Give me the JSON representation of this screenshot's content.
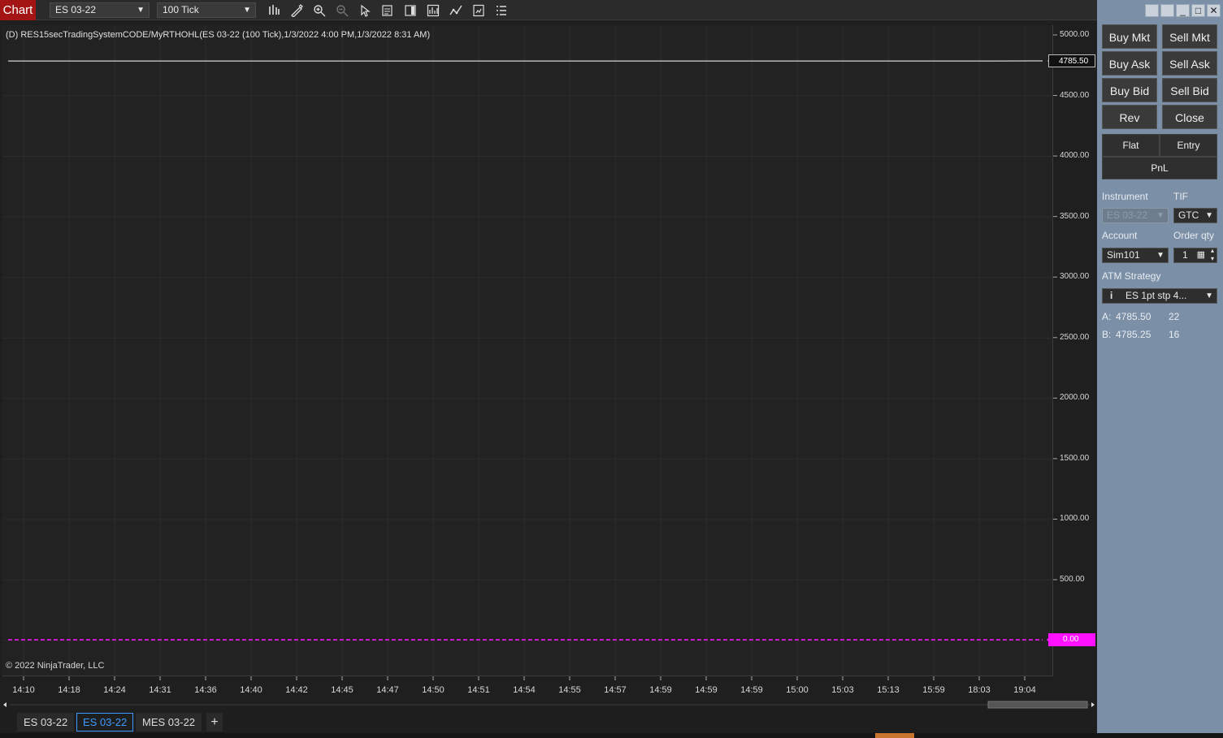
{
  "toolbar": {
    "app_tab": "Chart",
    "instrument": "ES 03-22",
    "interval": "100 Tick",
    "tools": [
      "bar-type-icon",
      "drawing-tool-icon",
      "zoom-in-icon",
      "zoom-out-icon",
      "pointer-icon",
      "data-box-icon",
      "chart-trader-icon",
      "strategies-icon",
      "indicators-icon",
      "templates-icon",
      "properties-icon"
    ]
  },
  "chart": {
    "title": "(D) RES15secTradingSystemCODE/MyRTHOHL(ES 03-22 (100 Tick),1/3/2022 4:00 PM,1/3/2022 8:31 AM)",
    "copyright": "© 2022 NinjaTrader, LLC",
    "last_price": "4785.50",
    "zero_line": "0.00",
    "colors": {
      "background": "#222222",
      "price_line": "#ffffff",
      "zero_line": "#ff10ff"
    }
  },
  "chart_data": {
    "type": "line",
    "title": "(D) RES15secTradingSystemCODE/MyRTHOHL(ES 03-22 (100 Tick),1/3/2022 4:00 PM,1/3/2022 8:31 AM)",
    "x": [
      "14:10",
      "14:18",
      "14:24",
      "14:31",
      "14:36",
      "14:40",
      "14:42",
      "14:45",
      "14:47",
      "14:50",
      "14:51",
      "14:54",
      "14:55",
      "14:57",
      "14:59",
      "14:59",
      "14:59",
      "15:00",
      "15:03",
      "15:13",
      "15:59",
      "18:03",
      "19:04"
    ],
    "y_ticks": [
      "5000.00",
      "4500.00",
      "4000.00",
      "3500.00",
      "3000.00",
      "2500.00",
      "2000.00",
      "1500.00",
      "1000.00",
      "500.00"
    ],
    "ylim": [
      -200,
      5200
    ],
    "series": [
      {
        "values": [
          4785,
          4785,
          4785,
          4785,
          4785,
          4785,
          4785,
          4785,
          4785,
          4785,
          4785,
          4785,
          4785,
          4785,
          4785,
          4785,
          4785,
          4785,
          4785,
          4785,
          4785,
          4785,
          4785.5
        ]
      },
      {
        "values": [
          0,
          0,
          0,
          0,
          0,
          0,
          0,
          0,
          0,
          0,
          0,
          0,
          0,
          0,
          0,
          0,
          0,
          0,
          0,
          0,
          0,
          0,
          0
        ]
      }
    ],
    "grid": true
  },
  "bottom_tabs": [
    {
      "label": "ES 03-22",
      "active": false
    },
    {
      "label": "ES 03-22",
      "active": true
    },
    {
      "label": "MES 03-22",
      "active": false
    }
  ],
  "add_tab": "+",
  "order_panel": {
    "buttons": {
      "buy_mkt": "Buy Mkt",
      "sell_mkt": "Sell Mkt",
      "buy_ask": "Buy Ask",
      "sell_ask": "Sell Ask",
      "buy_bid": "Buy Bid",
      "sell_bid": "Sell Bid",
      "rev": "Rev",
      "close": "Close"
    },
    "position": {
      "flat": "Flat",
      "entry": "Entry",
      "pnl": "PnL"
    },
    "labels": {
      "instrument": "Instrument",
      "tif": "TIF",
      "account": "Account",
      "order_qty": "Order qty",
      "atm_strategy": "ATM Strategy"
    },
    "values": {
      "instrument": "ES 03-22",
      "tif": "GTC",
      "account": "Sim101",
      "order_qty": "1",
      "atm_strategy": "ES 1pt stp 4..."
    },
    "quotes": {
      "ask_label": "A:",
      "ask_price": "4785.50",
      "ask_size": "22",
      "bid_label": "B:",
      "bid_price": "4785.25",
      "bid_size": "16"
    }
  }
}
